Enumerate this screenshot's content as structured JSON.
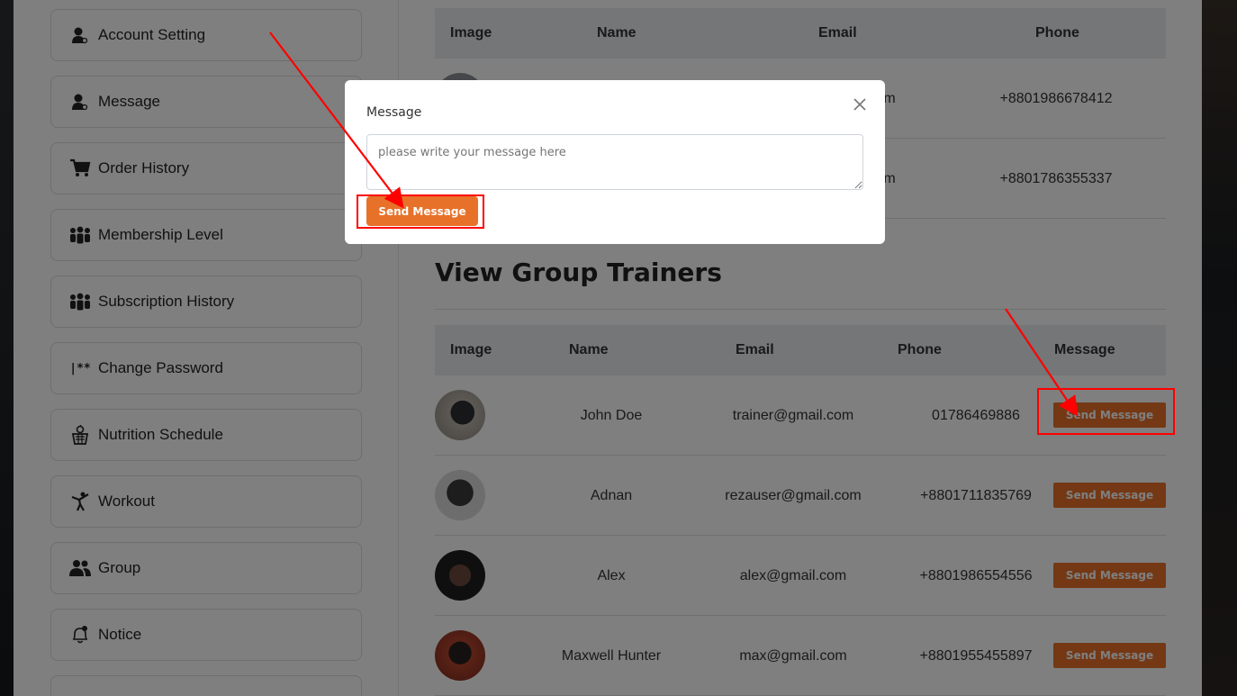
{
  "sidebar": {
    "items": [
      {
        "label": "Account Setting",
        "icon": "user-gear-icon"
      },
      {
        "label": "Message",
        "icon": "user-message-icon"
      },
      {
        "label": "Order History",
        "icon": "cart-icon"
      },
      {
        "label": "Membership Level",
        "icon": "users-icon"
      },
      {
        "label": "Subscription History",
        "icon": "users-icon"
      },
      {
        "label": "Change Password",
        "icon": "password-icon"
      },
      {
        "label": "Nutrition Schedule",
        "icon": "apple-basket-icon"
      },
      {
        "label": "Workout",
        "icon": "workout-icon"
      },
      {
        "label": "Group",
        "icon": "group-icon"
      },
      {
        "label": "Notice",
        "icon": "bell-icon"
      }
    ]
  },
  "top_table": {
    "headers": [
      "Image",
      "Name",
      "Email",
      "Phone"
    ],
    "rows": [
      {
        "email_tail": "m",
        "phone": "+8801986678412"
      },
      {
        "email_tail": "m",
        "phone": "+8801786355337"
      }
    ]
  },
  "group_trainers": {
    "title": "View Group Trainers",
    "headers": [
      "Image",
      "Name",
      "Email",
      "Phone",
      "Message"
    ],
    "rows": [
      {
        "name": "John Doe",
        "email": "trainer@gmail.com",
        "phone": "01786469886",
        "action": "Send Message"
      },
      {
        "name": "Adnan",
        "email": "rezauser@gmail.com",
        "phone": "+8801711835769",
        "action": "Send Message"
      },
      {
        "name": "Alex",
        "email": "alex@gmail.com",
        "phone": "+8801986554556",
        "action": "Send Message"
      },
      {
        "name": "Maxwell Hunter",
        "email": "max@gmail.com",
        "phone": "+8801955455897",
        "action": "Send Message"
      }
    ]
  },
  "modal": {
    "title": "Message",
    "placeholder": "please write your message here",
    "send_label": "Send Message",
    "close_icon": "close-icon"
  },
  "colors": {
    "accent": "#e8712a",
    "annotation": "#ff0000",
    "overlay": "rgba(0,0,0,0.5)"
  }
}
